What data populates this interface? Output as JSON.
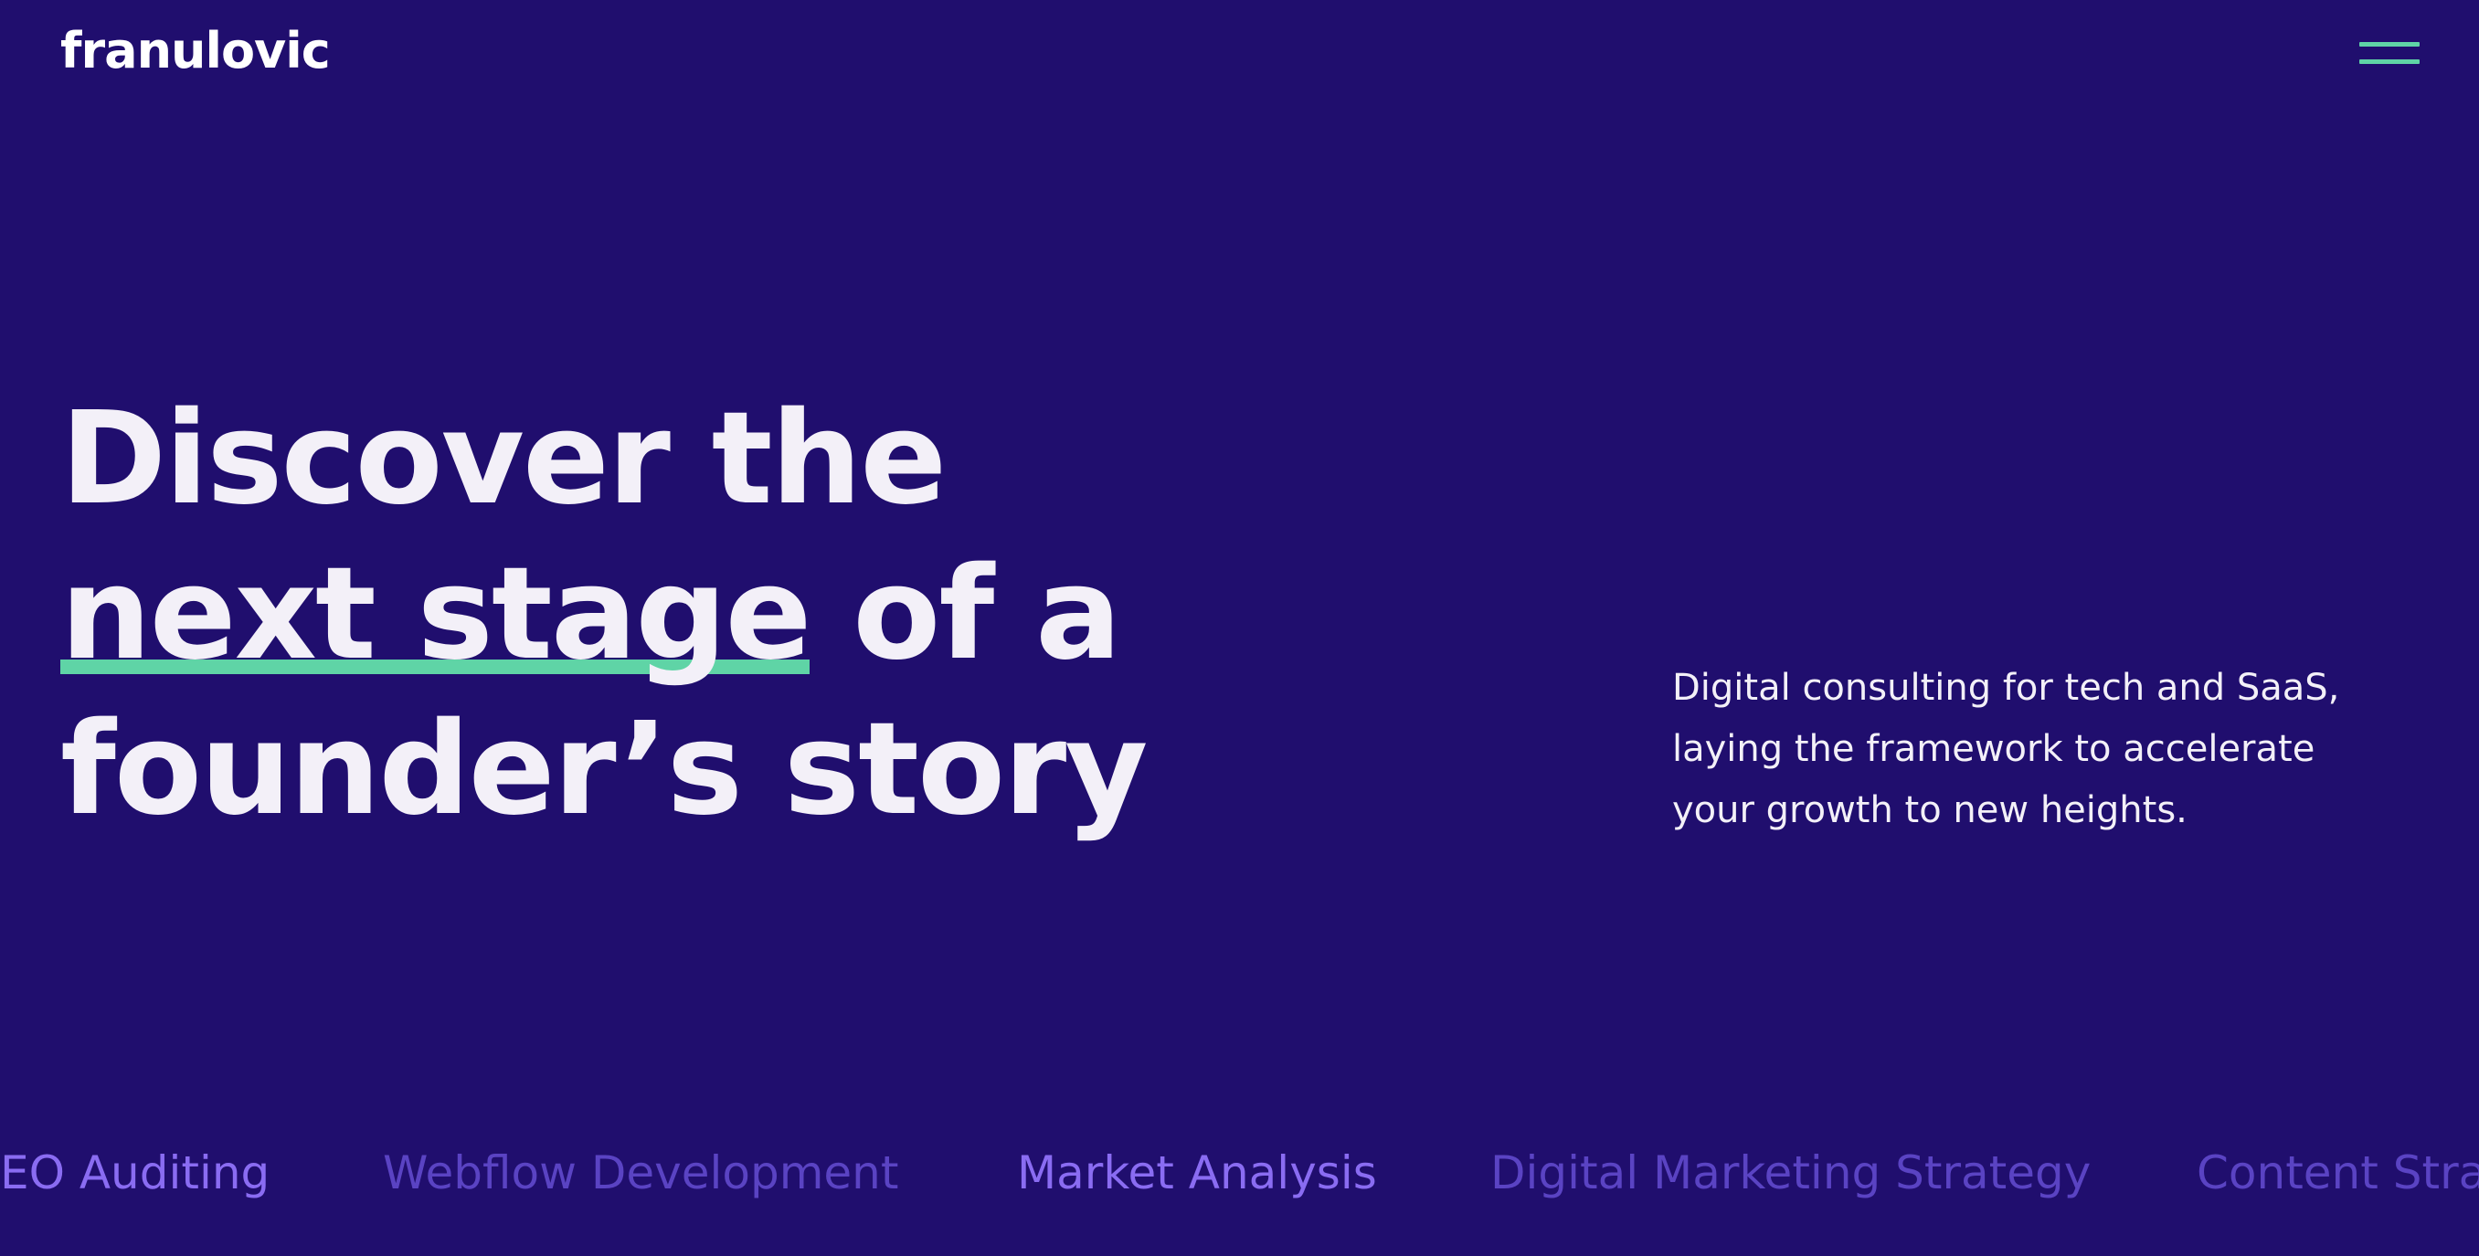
{
  "header": {
    "logo": "franulovic",
    "menu_icon": "hamburger-menu-icon"
  },
  "hero": {
    "headline_line1": "Discover the",
    "headline_highlight": "next stage",
    "headline_line2_rest": " of a",
    "headline_line3": "founder’s story",
    "tagline_line1": "Digital consulting for tech and SaaS,",
    "tagline_line2": "laying the framework to accelerate",
    "tagline_line3": "your growth to new heights."
  },
  "services_marquee": {
    "items": [
      "EO Auditing",
      "Webflow Development",
      "Market Analysis",
      "Digital Marketing Strategy",
      "Content Stra"
    ]
  },
  "colors": {
    "background": "#200e6e",
    "text": "#f3f0f8",
    "accent_green": "#5fd4a6",
    "marquee_dim": "#5a43c3",
    "marquee_bright": "#8a6cf2"
  }
}
